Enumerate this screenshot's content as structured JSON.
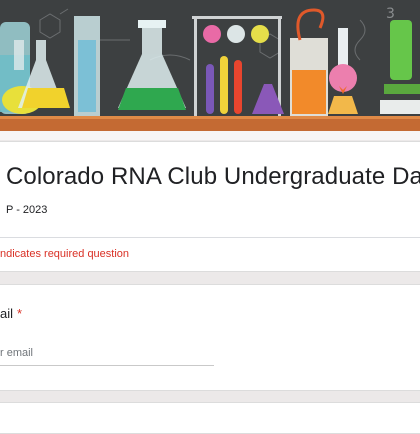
{
  "form": {
    "title": "Colorado RNA Club Undergraduate Day",
    "subtitle": "P - 2023",
    "required_note": "ndicates required question"
  },
  "question": {
    "label": "ail",
    "required_mark": "*",
    "placeholder": "r email"
  },
  "colors": {
    "accent_required": "#d93025",
    "banner_bg": "#3a3d3e",
    "page_bg": "#ece9e9"
  }
}
